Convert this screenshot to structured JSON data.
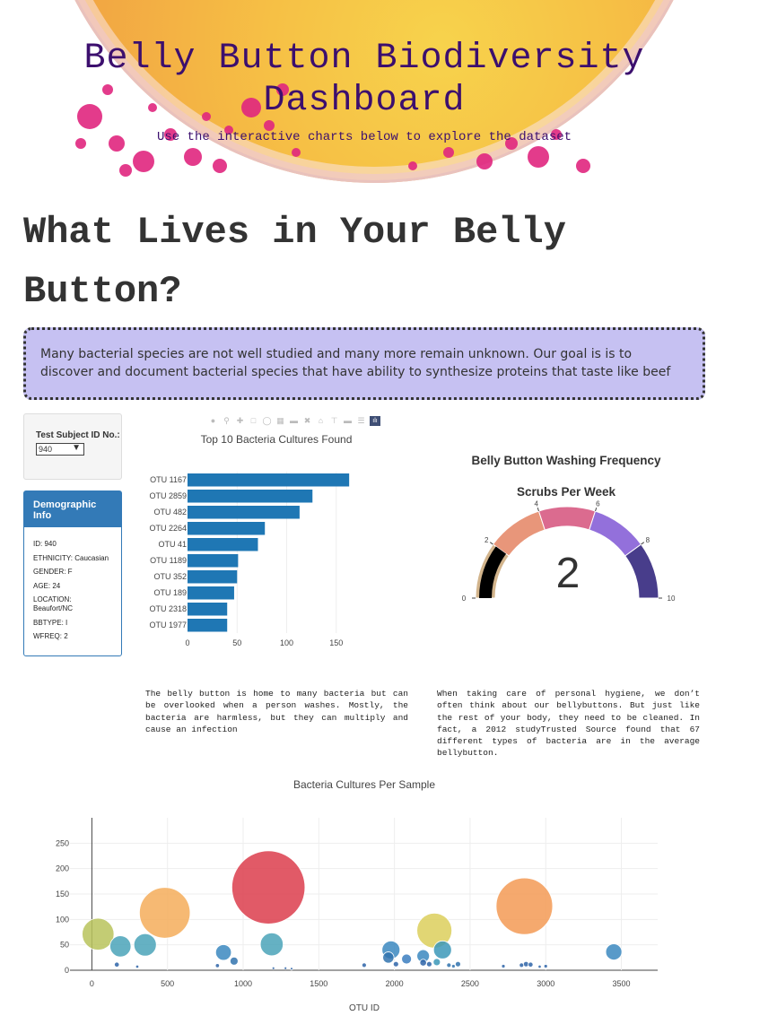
{
  "hero": {
    "title": "Belly Button Biodiversity Dashboard",
    "subtitle": "Use the interactive charts below to explore the dataset"
  },
  "page_title": "What Lives in Your Belly Button?",
  "callout": "Many bacterial species are not well studied and many more remain unknown. Our goal is is to discover and document bacterial species that have ability to synthesize proteins that taste like beef",
  "selector": {
    "label": "Test Subject ID No.:",
    "value": "940"
  },
  "demographic": {
    "title": "Demographic Info",
    "lines": [
      "ID: 940",
      "ETHNICITY: Caucasian",
      "GENDER: F",
      "AGE: 24",
      "LOCATION: Beaufort/NC",
      "BBTYPE: I",
      "WFREQ: 2"
    ]
  },
  "modebar_icons": [
    "camera-icon",
    "zoom-icon",
    "pan-icon",
    "box-select-icon",
    "lasso-icon",
    "zoom-in-icon",
    "zoom-out-icon",
    "autoscale-icon",
    "reset-axes-icon",
    "spike-lines-icon",
    "hover-closest-icon",
    "hover-compare-icon",
    "plotly-logo-icon"
  ],
  "paragraphs": {
    "left": "The belly button is home to many bacteria but can be overlooked when a person washes. Mostly, the bacteria are harmless, but they can multiply and cause an infection",
    "right": "When taking care of personal hygiene, we don’t often think about our bellybuttons. But just like the rest of your body, they need to be cleaned. In fact, a 2012 studyTrusted Source found that 67 different types of bacteria are in the average bellybutton."
  },
  "chart_data": [
    {
      "type": "bar",
      "orientation": "horizontal",
      "title": "Top 10 Bacteria Cultures Found",
      "categories": [
        "OTU 1167",
        "OTU 2859",
        "OTU 482",
        "OTU 2264",
        "OTU 41",
        "OTU 1189",
        "OTU 352",
        "OTU 189",
        "OTU 2318",
        "OTU 1977"
      ],
      "values": [
        163,
        126,
        113,
        78,
        71,
        51,
        50,
        47,
        40,
        40
      ],
      "xticks": [
        0,
        50,
        100,
        150
      ],
      "xlim": [
        0,
        171
      ],
      "color": "#1f77b4"
    },
    {
      "type": "gauge",
      "title": "Belly Button Washing Frequency",
      "subtitle": "Scrubs Per Week",
      "value": 2,
      "range": [
        0,
        10
      ],
      "ticks": [
        0,
        2,
        4,
        6,
        8,
        10
      ],
      "band_colors": [
        "#d2b48c",
        "#e8967a",
        "#db6b8f",
        "#9370db",
        "#483d8b"
      ],
      "bar_color": "#000000"
    },
    {
      "type": "scatter",
      "title": "Bacteria Cultures Per Sample",
      "xlabel": "OTU ID",
      "xticks": [
        0,
        500,
        1000,
        1500,
        2000,
        2500,
        3000,
        3500
      ],
      "yticks": [
        0,
        50,
        100,
        150,
        200,
        250
      ],
      "xlim": [
        -370,
        3740
      ],
      "ylim": [
        0,
        300
      ],
      "points": [
        {
          "x": 41,
          "y": 71,
          "c": "#b9c35c"
        },
        {
          "x": 189,
          "y": 47,
          "c": "#4aa3b8"
        },
        {
          "x": 352,
          "y": 50,
          "c": "#4aa3b8"
        },
        {
          "x": 482,
          "y": 113,
          "c": "#f4ad5b"
        },
        {
          "x": 1167,
          "y": 163,
          "c": "#dc3d4c"
        },
        {
          "x": 1189,
          "y": 51,
          "c": "#4aa3b8"
        },
        {
          "x": 2264,
          "y": 78,
          "c": "#dccf5c"
        },
        {
          "x": 2859,
          "y": 126,
          "c": "#f39a55"
        },
        {
          "x": 870,
          "y": 35,
          "c": "#3b88c0"
        },
        {
          "x": 940,
          "y": 18,
          "c": "#3173ae"
        },
        {
          "x": 1977,
          "y": 40,
          "c": "#3b88c0"
        },
        {
          "x": 2318,
          "y": 40,
          "c": "#3b98b8"
        },
        {
          "x": 3450,
          "y": 36,
          "c": "#3b88c0"
        },
        {
          "x": 1960,
          "y": 25,
          "c": "#3173ae"
        },
        {
          "x": 2080,
          "y": 22,
          "c": "#3b7ec0"
        },
        {
          "x": 2190,
          "y": 28,
          "c": "#3b88c0"
        },
        {
          "x": 2280,
          "y": 16,
          "c": "#3b98b8"
        },
        {
          "x": 2190,
          "y": 15,
          "c": "#2e64a8"
        },
        {
          "x": 2230,
          "y": 12,
          "c": "#2e64a8"
        },
        {
          "x": 2010,
          "y": 12,
          "c": "#2e64a8"
        },
        {
          "x": 2360,
          "y": 10,
          "c": "#3173ae"
        },
        {
          "x": 2420,
          "y": 12,
          "c": "#3173ae"
        },
        {
          "x": 2390,
          "y": 8,
          "c": "#3173ae"
        },
        {
          "x": 165,
          "y": 11,
          "c": "#2e64a8"
        },
        {
          "x": 830,
          "y": 9,
          "c": "#2e64a8"
        },
        {
          "x": 1800,
          "y": 10,
          "c": "#2e64a8"
        },
        {
          "x": 2870,
          "y": 12,
          "c": "#2e64a8"
        },
        {
          "x": 2900,
          "y": 11,
          "c": "#2e64a8"
        },
        {
          "x": 2840,
          "y": 10,
          "c": "#2e64a8"
        },
        {
          "x": 3000,
          "y": 8,
          "c": "#2e64a8"
        },
        {
          "x": 2720,
          "y": 8,
          "c": "#2e64a8"
        },
        {
          "x": 2960,
          "y": 7,
          "c": "#2e64a8"
        },
        {
          "x": 300,
          "y": 7,
          "c": "#2e64a8"
        },
        {
          "x": 1200,
          "y": 4,
          "c": "#2e64a8"
        },
        {
          "x": 1280,
          "y": 4,
          "c": "#2e64a8"
        },
        {
          "x": 1320,
          "y": 3,
          "c": "#2e64a8"
        }
      ]
    }
  ]
}
